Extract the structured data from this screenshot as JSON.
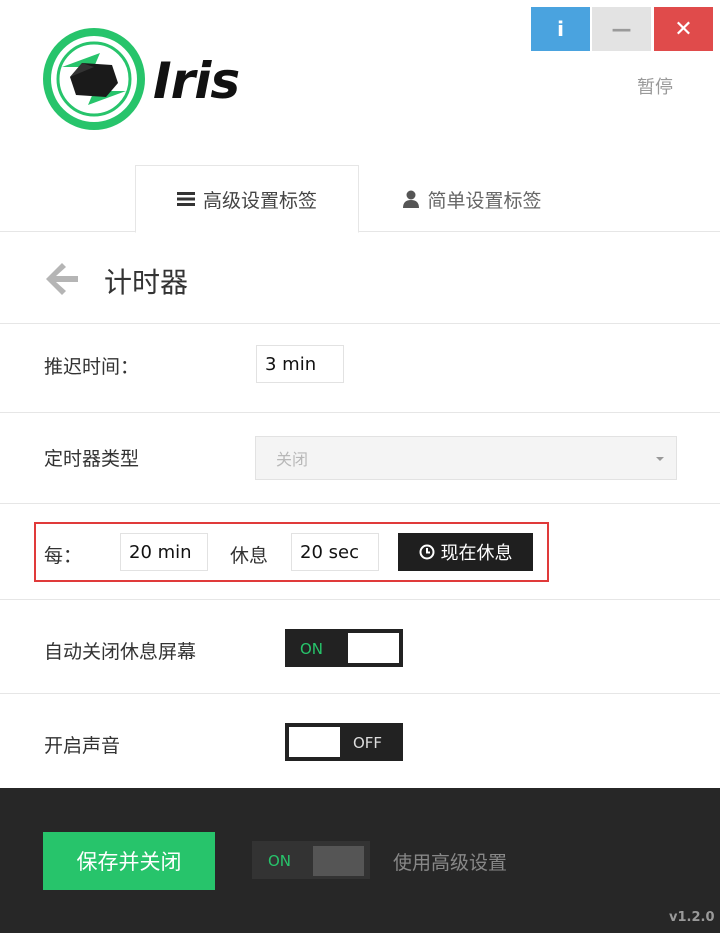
{
  "app": {
    "name": "Iris",
    "version": "v1.2.0"
  },
  "window": {
    "info": "i",
    "minimize": "—",
    "close": "✕",
    "pause_label": "暂停"
  },
  "tabs": [
    {
      "label": "高级设置标签",
      "icon": "menu-icon",
      "active": true
    },
    {
      "label": "简单设置标签",
      "icon": "user-icon",
      "active": false
    }
  ],
  "section": {
    "title": "计时器",
    "back_icon": "back-arrow-icon"
  },
  "settings": {
    "postpone": {
      "label": "推迟时间：",
      "value": "3 min"
    },
    "timer_type": {
      "label": "定时器类型",
      "value": "关闭"
    },
    "every": {
      "label": "每：",
      "interval": "20 min",
      "rest_label": "休息",
      "rest_duration": "20 sec",
      "rest_now_button": "现在休息"
    },
    "auto_close": {
      "label": "自动关闭休息屏幕",
      "state": "ON"
    },
    "sound": {
      "label": "开启声音",
      "state": "OFF"
    }
  },
  "footer": {
    "save_button": "保存并关闭",
    "advanced_toggle_state": "ON",
    "advanced_label": "使用高级设置"
  },
  "colors": {
    "accent_green": "#27c46b",
    "info_blue": "#4aa3df",
    "close_red": "#e04b4b",
    "highlight_red": "#e03a3a",
    "footer_bg": "#272727"
  }
}
